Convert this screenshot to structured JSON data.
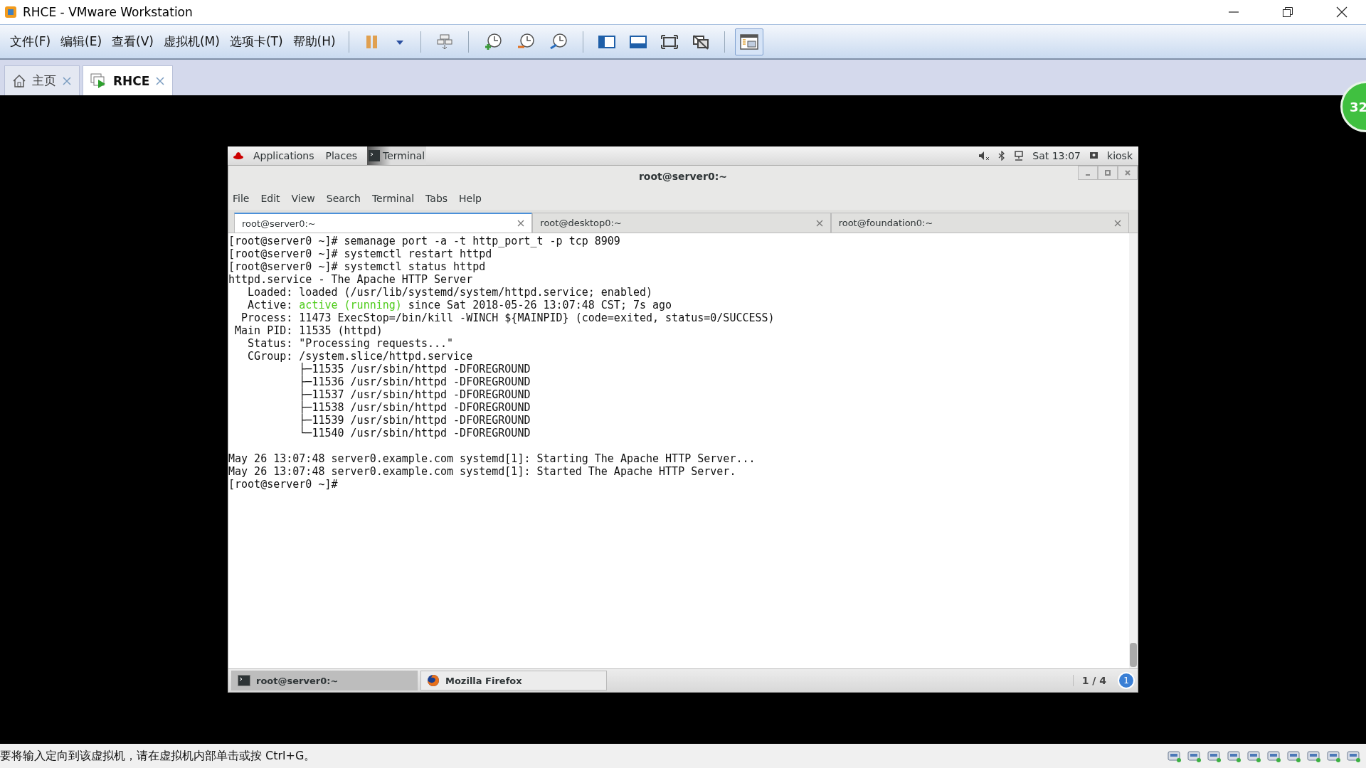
{
  "window": {
    "title": "RHCE - VMware Workstation"
  },
  "menu": [
    "文件(F)",
    "编辑(E)",
    "查看(V)",
    "虚拟机(M)",
    "选项卡(T)",
    "帮助(H)"
  ],
  "toolbar": [
    {
      "kind": "pause",
      "pressed": false
    },
    {
      "kind": "dropdown",
      "pressed": false
    },
    {
      "kind": "sendkeys",
      "pressed": false
    },
    {
      "kind": "snapshot",
      "pressed": false
    },
    {
      "kind": "revert",
      "pressed": false
    },
    {
      "kind": "manage",
      "pressed": false
    },
    {
      "kind": "sidebar",
      "pressed": false
    },
    {
      "kind": "thumbs",
      "pressed": false
    },
    {
      "kind": "fullscreen",
      "pressed": false
    },
    {
      "kind": "nofit",
      "pressed": false
    },
    {
      "kind": "unity",
      "pressed": true
    }
  ],
  "tabs": [
    {
      "label": "主页",
      "kind": "home",
      "selected": false
    },
    {
      "label": "RHCE",
      "kind": "vm",
      "selected": true
    }
  ],
  "badge": "32",
  "guest": {
    "top_bar": {
      "menus": [
        "Applications",
        "Places"
      ],
      "app": "Terminal",
      "clock": "Sat 13:07",
      "user": "kiosk"
    },
    "terminal": {
      "title": "root@server0:~",
      "menu": [
        "File",
        "Edit",
        "View",
        "Search",
        "Terminal",
        "Tabs",
        "Help"
      ],
      "tabs": [
        {
          "label": "root@server0:~",
          "selected": true
        },
        {
          "label": "root@desktop0:~",
          "selected": false
        },
        {
          "label": "root@foundation0:~",
          "selected": false
        }
      ],
      "lines": [
        {
          "segments": [
            {
              "text": "[root@server0 ~]# semanage port -a -t http_port_t -p tcp 8909"
            }
          ]
        },
        {
          "segments": [
            {
              "text": "[root@server0 ~]# systemctl restart httpd"
            }
          ]
        },
        {
          "segments": [
            {
              "text": "[root@server0 ~]# systemctl status httpd"
            }
          ]
        },
        {
          "segments": [
            {
              "text": "httpd.service - The Apache HTTP Server"
            }
          ]
        },
        {
          "segments": [
            {
              "text": "   Loaded: loaded (/usr/lib/systemd/system/httpd.service; enabled)"
            }
          ]
        },
        {
          "segments": [
            {
              "text": "   Active: "
            },
            {
              "text": "active (running)",
              "kind": "ok"
            },
            {
              "text": " since Sat 2018-05-26 13:07:48 CST; 7s ago"
            }
          ]
        },
        {
          "segments": [
            {
              "text": "  Process: 11473 ExecStop=/bin/kill -WINCH ${MAINPID} (code=exited, status=0/SUCCESS)"
            }
          ]
        },
        {
          "segments": [
            {
              "text": " Main PID: 11535 (httpd)"
            }
          ]
        },
        {
          "segments": [
            {
              "text": "   Status: \"Processing requests...\""
            }
          ]
        },
        {
          "segments": [
            {
              "text": "   CGroup: /system.slice/httpd.service"
            }
          ]
        },
        {
          "segments": [
            {
              "text": "           ├─11535 /usr/sbin/httpd -DFOREGROUND"
            }
          ]
        },
        {
          "segments": [
            {
              "text": "           ├─11536 /usr/sbin/httpd -DFOREGROUND"
            }
          ]
        },
        {
          "segments": [
            {
              "text": "           ├─11537 /usr/sbin/httpd -DFOREGROUND"
            }
          ]
        },
        {
          "segments": [
            {
              "text": "           ├─11538 /usr/sbin/httpd -DFOREGROUND"
            }
          ]
        },
        {
          "segments": [
            {
              "text": "           ├─11539 /usr/sbin/httpd -DFOREGROUND"
            }
          ]
        },
        {
          "segments": [
            {
              "text": "           └─11540 /usr/sbin/httpd -DFOREGROUND"
            }
          ]
        },
        {
          "gap_before": true,
          "segments": [
            {
              "text": "May 26 13:07:48 server0.example.com systemd[1]: Starting The Apache HTTP Server..."
            }
          ]
        },
        {
          "segments": [
            {
              "text": "May 26 13:07:48 server0.example.com systemd[1]: Started The Apache HTTP Server."
            }
          ]
        },
        {
          "segments": [
            {
              "text": "[root@server0 ~]#"
            }
          ]
        }
      ]
    },
    "taskbar": {
      "items": [
        {
          "label": "root@server0:~",
          "kind": "terminal",
          "selected": true
        },
        {
          "label": "Mozilla Firefox",
          "kind": "firefox",
          "selected": false
        }
      ],
      "workspace": "1 / 4",
      "notifications": "1"
    }
  },
  "status_bar": {
    "message": "要将输入定向到该虚拟机，请在虚拟机内部单击或按 Ctrl+G。"
  }
}
